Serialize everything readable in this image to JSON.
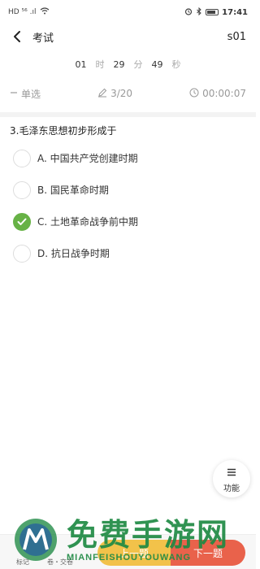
{
  "status_bar": {
    "left_text": "HD ⁵⁶ .ıl",
    "time": "17:41"
  },
  "header": {
    "title": "考试",
    "user_id": "s01"
  },
  "countdown": {
    "hours": "01",
    "hours_unit": "时",
    "minutes": "29",
    "minutes_unit": "分",
    "seconds": "49",
    "seconds_unit": "秒"
  },
  "info": {
    "type_label": "单选",
    "progress": "3/20",
    "elapsed": "00:00:07"
  },
  "question": {
    "text": "3.毛泽东思想初步形成于"
  },
  "options": [
    {
      "label": "A. 中国共产党创建时期",
      "selected": false
    },
    {
      "label": "B. 国民革命时期",
      "selected": false
    },
    {
      "label": "C. 土地革命战争前中期",
      "selected": true
    },
    {
      "label": "D. 抗日战争时期",
      "selected": false
    }
  ],
  "function_button": {
    "label": "功能"
  },
  "bottom_bar": {
    "mark_label": "标记",
    "submit_label": "卷・交卷",
    "prev_label": "上一题",
    "next_label": "下一题"
  },
  "watermark": {
    "title": "免费手游网",
    "subtitle": "MIANFEISHOUYOUWANG"
  },
  "colors": {
    "accent_green": "#67b246",
    "prev_yellow": "#f2c24a",
    "next_red": "#e9624b"
  }
}
